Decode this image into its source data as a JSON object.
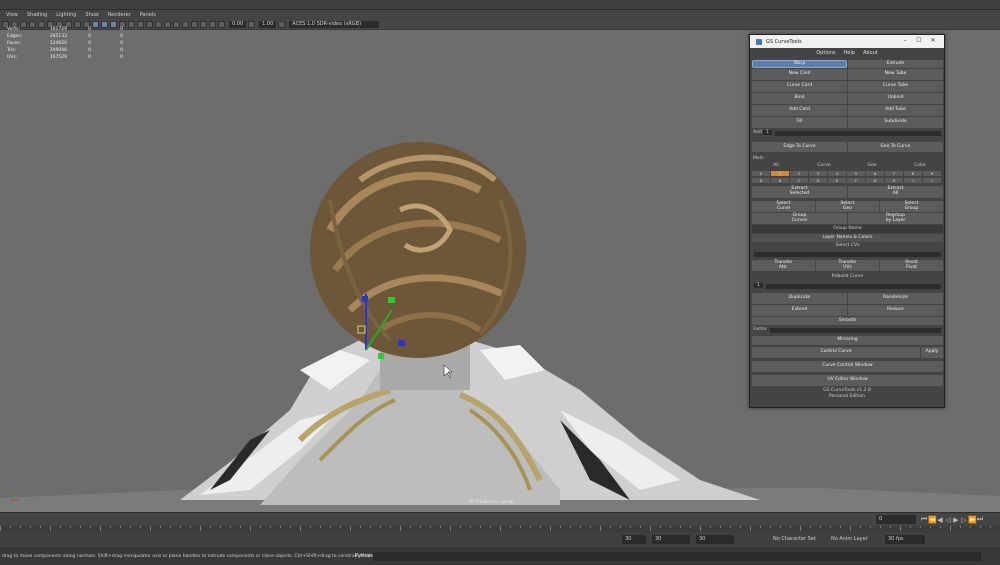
{
  "viewport_menu": [
    "View",
    "Shading",
    "Lighting",
    "Show",
    "Renderer",
    "Panels"
  ],
  "viewport_toolbar": {
    "exposure": "0.00",
    "gamma": "1.00",
    "color_space": "ACES 1.0 SDR-video (sRGB)"
  },
  "hud": {
    "rows": [
      {
        "label": "Verts:",
        "a": "161729",
        "b": "0",
        "c": "0"
      },
      {
        "label": "Edges:",
        "a": "285133",
        "b": "0",
        "c": "0"
      },
      {
        "label": "Faces:",
        "a": "124626",
        "b": "0",
        "c": "0"
      },
      {
        "label": "Tris:",
        "a": "249046",
        "b": "0",
        "c": "0"
      },
      {
        "label": "UVs:",
        "a": "167529",
        "b": "0",
        "c": "0"
      }
    ]
  },
  "camera_label": "3D PanZoom : persp",
  "timeline": {
    "current_frame": "0",
    "range_start": "30",
    "range_field_1": "30",
    "range_field_2": "30",
    "character_set": "No Character Set",
    "anim_layer": "No Anim Layer",
    "fps": "30 fps"
  },
  "status": {
    "help_text": "drag to move components along normals. Shift+drag manipulator axis or plane handles to extrude components or clone objects. Ctrl+Shift+drag to constrain movement to a con",
    "script_lang": "Python"
  },
  "gs": {
    "title": "GS CurveTools",
    "menu": [
      "Options",
      "Help",
      "About"
    ],
    "warp": "Warp",
    "extrude": "Extrude",
    "new_card": "New Card",
    "new_tube": "New Tube",
    "curve_card": "Curve Card",
    "curve_tube": "Curve Tube",
    "bind": "Bind",
    "unbind": "Unbind",
    "add_card": "Add Card",
    "add_tube": "Add Tube",
    "fill": "Fill",
    "subdivide": "Subdivide",
    "add_label": "Add",
    "add_value": "1",
    "edge_to_curve": "Edge To Curve",
    "geo_to_curve": "Geo To Curve",
    "main_label": "Main",
    "col_all": "All",
    "col_curve": "Curve",
    "col_geo": "Geo",
    "col_color": "Color",
    "layers_row1": [
      "0",
      "1",
      "2",
      "3",
      "4",
      "5",
      "6",
      "7",
      "8",
      "9"
    ],
    "layers_row2": [
      "A",
      "B",
      "C",
      "D",
      "E",
      "F",
      "G",
      "H",
      "I",
      "J"
    ],
    "extract_selected": "Extract\nSelected",
    "extract_all": "Extract\nAll",
    "select_curve": "Select\nCurve",
    "select_geo": "Select\nGeo",
    "select_group": "Select\nGroup",
    "group_curves": "Group\nCurves",
    "regroup_by_layer": "Regroup\nby Layer",
    "group_name": "Group Name",
    "layer_names_colors": "Layer Names & Colors",
    "select_cvs": "Select CVs",
    "transfer_attr": "Transfer\nAttr.",
    "transfer_uvs": "Transfer\nUVs",
    "reset_pivot": "Reset\nPivot",
    "rebuild_curve": "Rebuild Curve",
    "rebuild_value": "1",
    "duplicate": "Duplicate",
    "randomize": "Randomize",
    "extend": "Extend",
    "reduce": "Reduce",
    "smooth": "Smooth",
    "factor_label": "Factor",
    "mirroring": "Mirroring",
    "control_curve": "Control Curve",
    "apply": "Apply",
    "curve_control_window": "Curve Control Window",
    "uv_editor_window": "UV Editor Window",
    "version": "GS CurveTools v1.2.8",
    "edition": "Personal Edition"
  }
}
